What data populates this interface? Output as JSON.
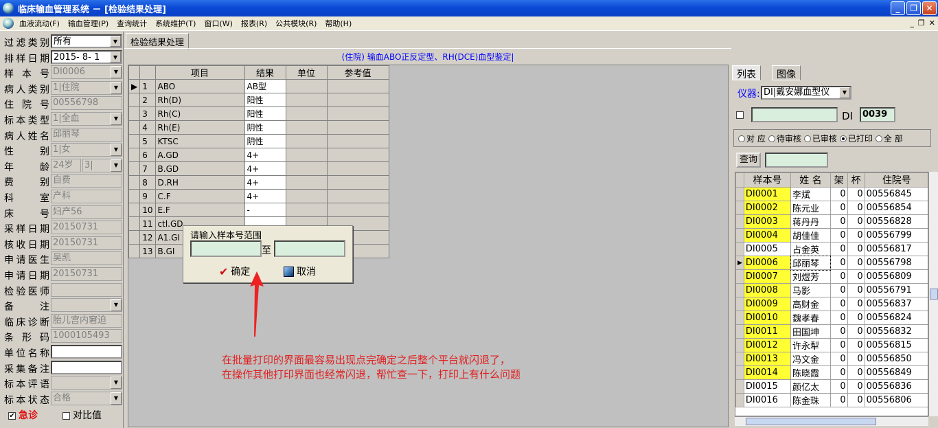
{
  "window": {
    "title": "临床输血管理系统 － [检验结果处理]",
    "min": "_",
    "restore": "❐",
    "close": "✕"
  },
  "menu": [
    "血液流动(F)",
    "输血管理(P)",
    "查询统计",
    "系统维护(T)",
    "窗口(W)",
    "报表(R)",
    "公共模块(R)",
    "帮助(H)"
  ],
  "mdi": {
    "min": "_",
    "restore": "❐",
    "close": "✕"
  },
  "left": {
    "rows": [
      {
        "label": "过滤类别",
        "value": "所有",
        "state": "active",
        "dd": true
      },
      {
        "label": "排样日期",
        "value": "2015- 8- 1",
        "state": "active",
        "dd": true
      },
      {
        "label": "样 本 号",
        "value": "DI0006",
        "state": "disabled",
        "dd": true
      },
      {
        "label": "病人类别",
        "value": "1|住院",
        "state": "disabled",
        "dd": true
      },
      {
        "label": "住 院 号",
        "value": "00556798",
        "state": "disabled"
      },
      {
        "label": "标本类型",
        "value": "1|全血",
        "state": "disabled",
        "dd": true
      },
      {
        "label": "病人姓名",
        "value": "邱丽琴",
        "state": "disabled"
      },
      {
        "label": "性 别",
        "value": "1|女",
        "state": "disabled",
        "dd": true
      },
      {
        "label": "年 龄",
        "value": "24岁",
        "value2": "3|",
        "state": "disabled"
      },
      {
        "label": "费 别",
        "value": "自费",
        "state": "disabled"
      },
      {
        "label": "科 室",
        "value": "产科",
        "state": "disabled"
      },
      {
        "label": "床 号",
        "value": "妇产56",
        "state": "disabled"
      },
      {
        "label": "采样日期",
        "value": "20150731",
        "state": "disabled"
      },
      {
        "label": "核收日期",
        "value": "20150731",
        "state": "disabled"
      },
      {
        "label": "申请医生",
        "value": "吴凯",
        "state": "disabled"
      },
      {
        "label": "申请日期",
        "value": "20150731",
        "state": "disabled"
      },
      {
        "label": "检验医师",
        "value": "",
        "state": "disabled"
      },
      {
        "label": "备 注",
        "value": "",
        "state": "disabled",
        "dd": true
      },
      {
        "label": "临床诊断",
        "value": "胎儿宫内窘迫",
        "state": "disabled"
      },
      {
        "label": "条 形 码",
        "value": "1000105493",
        "state": "disabled"
      },
      {
        "label": "单位名称",
        "value": "",
        "state": "blank"
      },
      {
        "label": "采集备注",
        "value": "",
        "state": "blank"
      },
      {
        "label": "标本评语",
        "value": "",
        "state": "disabled",
        "dd": true
      },
      {
        "label": "标本状态",
        "value": "合格",
        "state": "disabled",
        "dd": true
      }
    ],
    "urgent": "急诊",
    "urgent_check": "✔",
    "compare": "对比值"
  },
  "center": {
    "tab": "检验结果处理",
    "subtitle": "(住院) 输血ABO正反定型、RH(DCE)血型鉴定|",
    "headers": [
      "项目",
      "结果",
      "单位",
      "参考值"
    ],
    "rows": [
      {
        "n": "1",
        "item": "ABO",
        "result": "AB型"
      },
      {
        "n": "2",
        "item": "Rh(D)",
        "result": "阳性"
      },
      {
        "n": "3",
        "item": "Rh(C)",
        "result": "阳性"
      },
      {
        "n": "4",
        "item": "Rh(E)",
        "result": "阴性"
      },
      {
        "n": "5",
        "item": "KTSC",
        "result": "阴性"
      },
      {
        "n": "6",
        "item": "A.GD",
        "result": "4+"
      },
      {
        "n": "7",
        "item": "B.GD",
        "result": "4+"
      },
      {
        "n": "8",
        "item": "D.RH",
        "result": "4+"
      },
      {
        "n": "9",
        "item": "C.F",
        "result": "4+"
      },
      {
        "n": "10",
        "item": "E.F",
        "result": "-"
      },
      {
        "n": "11",
        "item": "ctl.GD",
        "result": ""
      },
      {
        "n": "12",
        "item": "A1.GI",
        "result": ""
      },
      {
        "n": "13",
        "item": "B.GI",
        "result": ""
      }
    ]
  },
  "popup": {
    "title": "请输入样本号范围",
    "to": "至",
    "ok": "确定",
    "cancel": "取消"
  },
  "note": {
    "line1": "在批量打印的界面最容易出现点完确定之后整个平台就闪退了，",
    "line2": "在操作其他打印界面也经常闪退，帮忙查一下，打印上有什么问题"
  },
  "right": {
    "tabs": [
      "列表",
      "图像"
    ],
    "instrument_label": "仪器:",
    "instrument_value": "DI|戴安娜血型仪",
    "di_label": "DI",
    "di_value": "0039",
    "radios": [
      "对 应",
      "待审核",
      "已审核",
      "已打印",
      "全 部"
    ],
    "query": "查询",
    "headers": [
      "样本号",
      "姓 名",
      "架",
      "杯",
      "住院号"
    ],
    "rows": [
      {
        "id": "DI0001",
        "name": "李斌",
        "a": "0",
        "b": "0",
        "no": "00556845",
        "hl": true
      },
      {
        "id": "DI0002",
        "name": "陈元业",
        "a": "0",
        "b": "0",
        "no": "00556854",
        "hl": true
      },
      {
        "id": "DI0003",
        "name": "蒋丹丹",
        "a": "0",
        "b": "0",
        "no": "00556828",
        "hl": true
      },
      {
        "id": "DI0004",
        "name": "胡佳佳",
        "a": "0",
        "b": "0",
        "no": "00556799",
        "hl": true
      },
      {
        "id": "DI0005",
        "name": "占金英",
        "a": "0",
        "b": "0",
        "no": "00556817",
        "hl": false
      },
      {
        "id": "DI0006",
        "name": "邱丽琴",
        "a": "0",
        "b": "0",
        "no": "00556798",
        "hl": true
      },
      {
        "id": "DI0007",
        "name": "刘煜芳",
        "a": "0",
        "b": "0",
        "no": "00556809",
        "hl": true
      },
      {
        "id": "DI0008",
        "name": "马影",
        "a": "0",
        "b": "0",
        "no": "00556791",
        "hl": true
      },
      {
        "id": "DI0009",
        "name": "高财金",
        "a": "0",
        "b": "0",
        "no": "00556837",
        "hl": true
      },
      {
        "id": "DI0010",
        "name": "魏孝春",
        "a": "0",
        "b": "0",
        "no": "00556824",
        "hl": true
      },
      {
        "id": "DI0011",
        "name": "田国坤",
        "a": "0",
        "b": "0",
        "no": "00556832",
        "hl": true
      },
      {
        "id": "DI0012",
        "name": "许永犁",
        "a": "0",
        "b": "0",
        "no": "00556815",
        "hl": true
      },
      {
        "id": "DI0013",
        "name": "冯文金",
        "a": "0",
        "b": "0",
        "no": "00556850",
        "hl": true
      },
      {
        "id": "DI0014",
        "name": "陈晓霞",
        "a": "0",
        "b": "0",
        "no": "00556849",
        "hl": true
      },
      {
        "id": "DI0015",
        "name": "颜亿太",
        "a": "0",
        "b": "0",
        "no": "00556836",
        "hl": false
      },
      {
        "id": "DI0016",
        "name": "陈金珠",
        "a": "0",
        "b": "0",
        "no": "00556806",
        "hl": false
      }
    ]
  }
}
